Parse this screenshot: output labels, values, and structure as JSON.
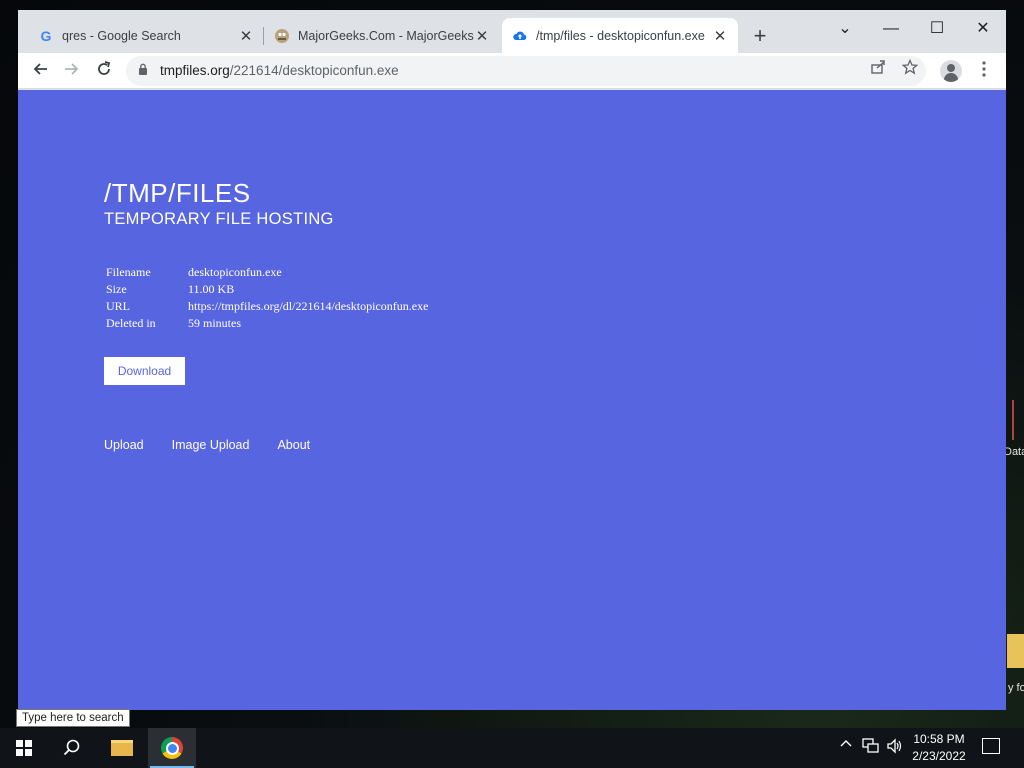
{
  "desktop": {
    "icon_label_1": "Data",
    "icon_label_2": "y fol"
  },
  "browser": {
    "tabs": [
      {
        "favicon": "G",
        "title": "qres - Google Search",
        "active": false
      },
      {
        "favicon": "majorgeeks-favicon",
        "title": "MajorGeeks.Com - MajorGeeks",
        "active": false
      },
      {
        "favicon": "cloud-upload-icon",
        "title": "/tmp/files - desktopiconfun.exe",
        "active": true
      }
    ],
    "new_tab": "+",
    "window_controls": {
      "tab_search": "⌄",
      "minimize": "—",
      "maximize": "☐",
      "close": "✕"
    },
    "address": {
      "host": "tmpfiles.org",
      "path": "/221614/desktopiconfun.exe"
    }
  },
  "page": {
    "title": "/TMP/FILES",
    "subtitle": "TEMPORARY FILE HOSTING",
    "file_info": [
      {
        "key": "Filename",
        "value": "desktopiconfun.exe"
      },
      {
        "key": "Size",
        "value": "11.00 KB"
      },
      {
        "key": "URL",
        "value": "https://tmpfiles.org/dl/221614/desktopiconfun.exe"
      },
      {
        "key": "Deleted in",
        "value": "59 minutes"
      }
    ],
    "download_label": "Download",
    "footer_links": [
      "Upload",
      "Image Upload",
      "About"
    ]
  },
  "taskbar": {
    "search_tooltip": "Type here to search",
    "time": "10:58 PM",
    "date": "2/23/2022"
  },
  "colors": {
    "page_background": "#5865e0",
    "tab_strip": "#dee1e6",
    "taskbar": "#101418"
  }
}
